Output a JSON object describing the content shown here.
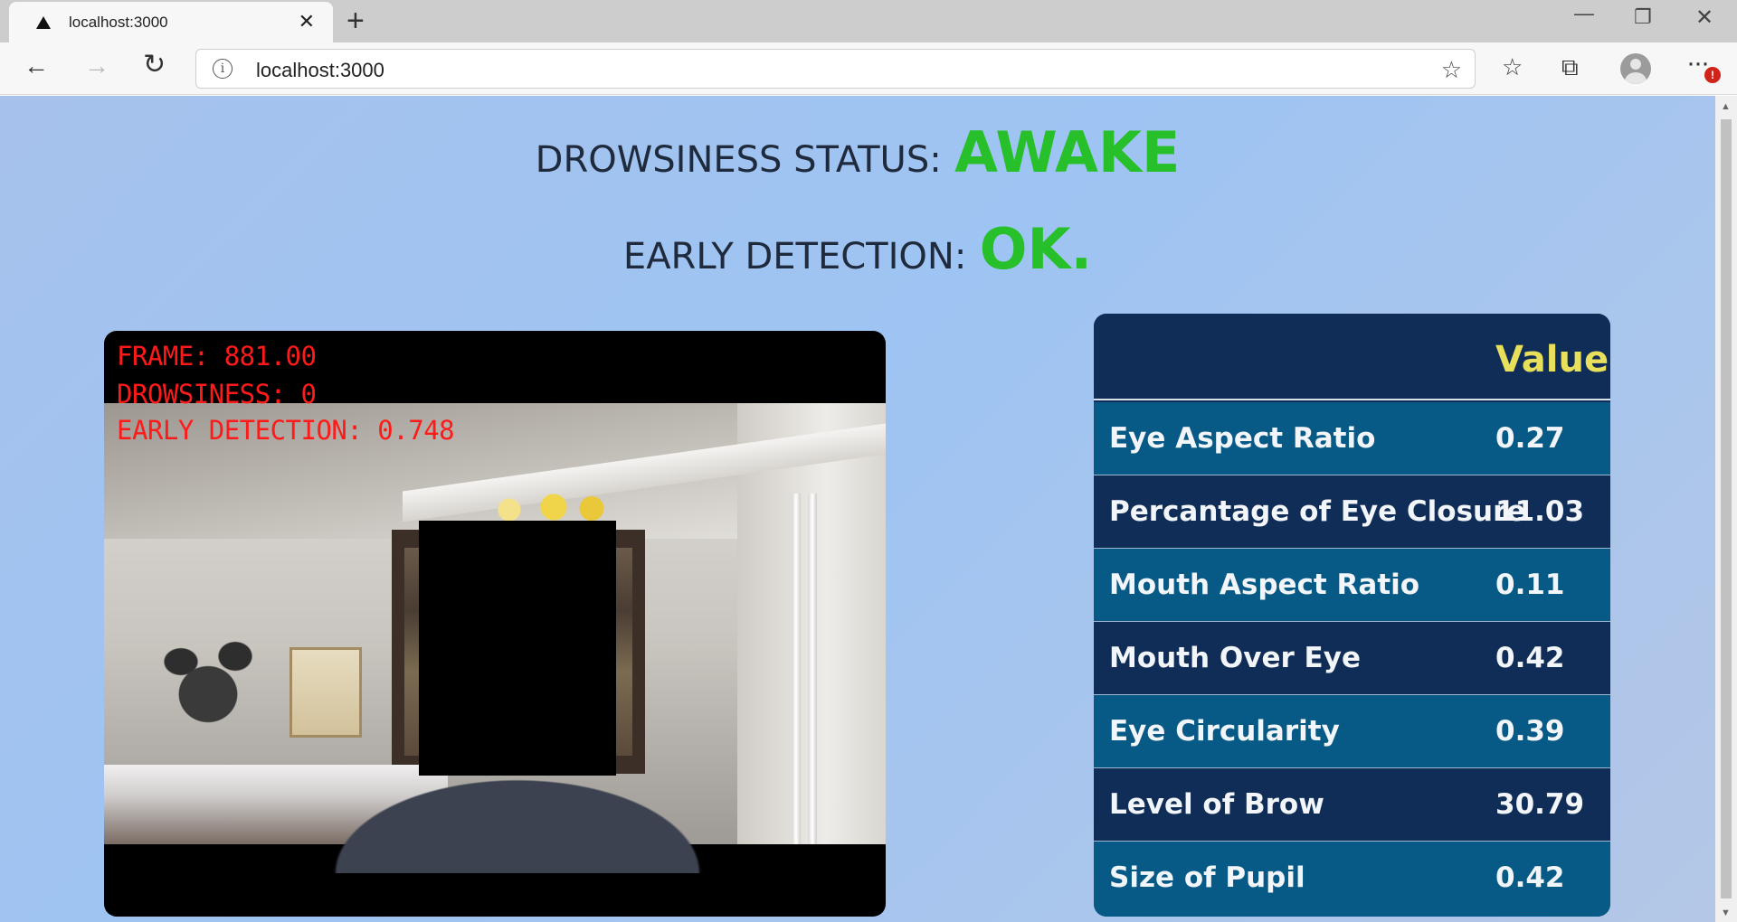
{
  "browser": {
    "tab_title": "localhost:3000",
    "tab_close": "✕",
    "new_tab": "+",
    "url": "localhost:3000",
    "window_controls": {
      "minimize": "—",
      "maximize": "❐",
      "close": "✕"
    },
    "icons": {
      "back": "arrow-left-icon",
      "forward": "arrow-right-icon",
      "reload": "reload-icon",
      "info": "info-icon",
      "add_favorite": "star-add-icon",
      "favorites": "favorites-icon",
      "collections": "collections-icon",
      "profile": "avatar-icon",
      "more": "more-icon"
    },
    "notification_badge": "!"
  },
  "status": {
    "drowsiness_label": "DROWSINESS STATUS:",
    "drowsiness_value": "AWAKE",
    "early_label": "EARLY DETECTION:",
    "early_value": "OK.",
    "value_color": "#27c02a"
  },
  "video": {
    "overlay_lines": [
      "FRAME: 881.00",
      "DROWSINESS: 0",
      "EARLY DETECTION: 0.748"
    ],
    "overlay_color": "#ff1a1a"
  },
  "metrics": {
    "header_value": "Value",
    "rows": [
      {
        "name": "Eye Aspect Ratio",
        "value": "0.27"
      },
      {
        "name": "Percantage of Eye Closure",
        "value": "11.03"
      },
      {
        "name": "Mouth Aspect Ratio",
        "value": "0.11"
      },
      {
        "name": "Mouth Over Eye",
        "value": "0.42"
      },
      {
        "name": "Eye Circularity",
        "value": "0.39"
      },
      {
        "name": "Level of Brow",
        "value": "30.79"
      },
      {
        "name": "Size of Pupil",
        "value": "0.42"
      }
    ],
    "colors": {
      "dark_row": "#0f2d56",
      "light_row": "#075a86",
      "header_value": "#e8e05a"
    }
  }
}
